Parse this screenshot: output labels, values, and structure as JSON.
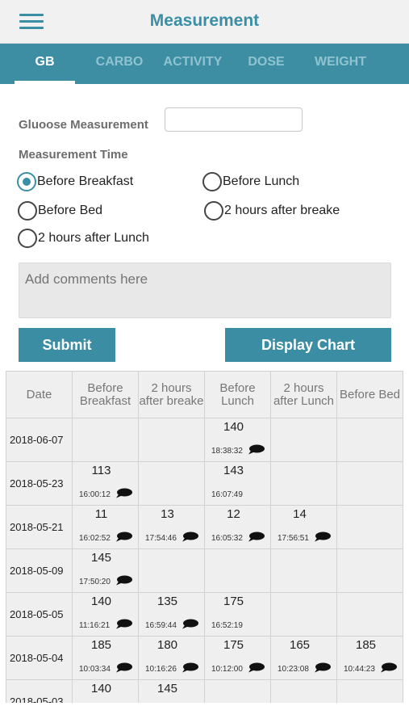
{
  "header": {
    "title": "Measurement",
    "menu_icon": "hamburger-menu-icon"
  },
  "tabs": [
    {
      "label": "GB",
      "active": true
    },
    {
      "label": "CARBO",
      "active": false
    },
    {
      "label": "ACTIVITY",
      "active": false
    },
    {
      "label": "DOSE",
      "active": false
    },
    {
      "label": "WEIGHT",
      "active": false
    }
  ],
  "form": {
    "glucose_label": "Gluoose Measurement",
    "glucose_value": "",
    "time_label": "Measurement Time",
    "options": [
      {
        "label": "Before Breakfast",
        "checked": true
      },
      {
        "label": "Before Lunch",
        "checked": false
      },
      {
        "label": "Before Bed",
        "checked": false
      },
      {
        "label": "2 hours after breake",
        "checked": false
      },
      {
        "label": "2 hours after Lunch",
        "checked": false
      }
    ],
    "comments_placeholder": "Add comments here",
    "submit_label": "Submit",
    "chart_label": "Display Chart"
  },
  "colors": {
    "accent": "#3e8ea3",
    "button": "#3b8da3",
    "cell_bg": "#efefef"
  },
  "table": {
    "headers": [
      "Date",
      "Before Breakfast",
      "2 hours after breake",
      "Before Lunch",
      "2 hours after Lunch",
      "Before Bed"
    ],
    "rows": [
      {
        "date": "2018-06-07",
        "cells": [
          null,
          null,
          {
            "value": "140",
            "time": "18:38:32"
          },
          null,
          null
        ]
      },
      {
        "date": "2018-05-23",
        "cells": [
          {
            "value": "113",
            "time": "16:00:12"
          },
          null,
          {
            "value": "143",
            "time": "16:07:49",
            "comment": false
          },
          null,
          null
        ]
      },
      {
        "date": "2018-05-21",
        "cells": [
          {
            "value": "11",
            "time": "16:02:52"
          },
          {
            "value": "13",
            "time": "17:54:46"
          },
          {
            "value": "12",
            "time": "16:05:32"
          },
          {
            "value": "14",
            "time": "17:56:51"
          },
          null
        ]
      },
      {
        "date": "2018-05-09",
        "cells": [
          {
            "value": "145",
            "time": "17:50:20"
          },
          null,
          null,
          null,
          null
        ]
      },
      {
        "date": "2018-05-05",
        "cells": [
          {
            "value": "140",
            "time": "11:16:21"
          },
          {
            "value": "135",
            "time": "16:59:44"
          },
          {
            "value": "175",
            "time": "16:52:19",
            "comment": false
          },
          null,
          null
        ]
      },
      {
        "date": "2018-05-04",
        "cells": [
          {
            "value": "185",
            "time": "10:03:34"
          },
          {
            "value": "180",
            "time": "10:16:26"
          },
          {
            "value": "175",
            "time": "10:12:00"
          },
          {
            "value": "165",
            "time": "10:23:08"
          },
          {
            "value": "185",
            "time": "10:44:23"
          }
        ]
      },
      {
        "date": "2018-05-03",
        "cells": [
          {
            "value": "140",
            "time": ""
          },
          {
            "value": "145",
            "time": ""
          },
          null,
          null,
          null
        ]
      }
    ]
  }
}
